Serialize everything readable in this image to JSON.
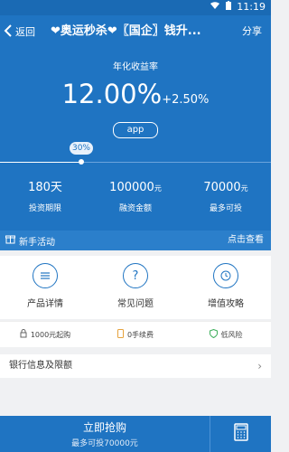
{
  "status_bar": {
    "time": "11:19"
  },
  "app_bar": {
    "back_label": "返回",
    "title": "❤奥运秒杀❤〖国企〗钱升...",
    "share_label": "分享"
  },
  "hero": {
    "rate_label": "年化收益率",
    "rate_main": "12.00%",
    "rate_bonus": "+2.50%",
    "tag": "app",
    "progress_label": "30%",
    "progress_value": 30,
    "stats": [
      {
        "value": "180天",
        "unit": "",
        "label": "投资期限"
      },
      {
        "value": "100000",
        "unit": "元",
        "label": "融资金额"
      },
      {
        "value": "70000",
        "unit": "元",
        "label": "最多可投"
      }
    ]
  },
  "new_bar": {
    "left_label": "新手活动",
    "right_label": "点击查看"
  },
  "features": [
    {
      "label": "产品详情",
      "icon": "list-icon"
    },
    {
      "label": "常见问题",
      "icon": "question-icon"
    },
    {
      "label": "增值攻略",
      "icon": "clock-icon"
    }
  ],
  "badges": [
    {
      "label": "1000元起购",
      "icon": "lock-icon"
    },
    {
      "label": "0手续费",
      "icon": "phone-icon"
    },
    {
      "label": "低风险",
      "icon": "shield-icon"
    }
  ],
  "bank": {
    "label": "银行信息及限额",
    "chevron": "›"
  },
  "bottom": {
    "buy_label": "立即抢购",
    "sub_label": "最多可投70000元",
    "calc_icon": "calculator-icon"
  },
  "colors": {
    "primary": "#1f74c2",
    "status": "#1a6ab4",
    "background": "#f0f1f3"
  }
}
